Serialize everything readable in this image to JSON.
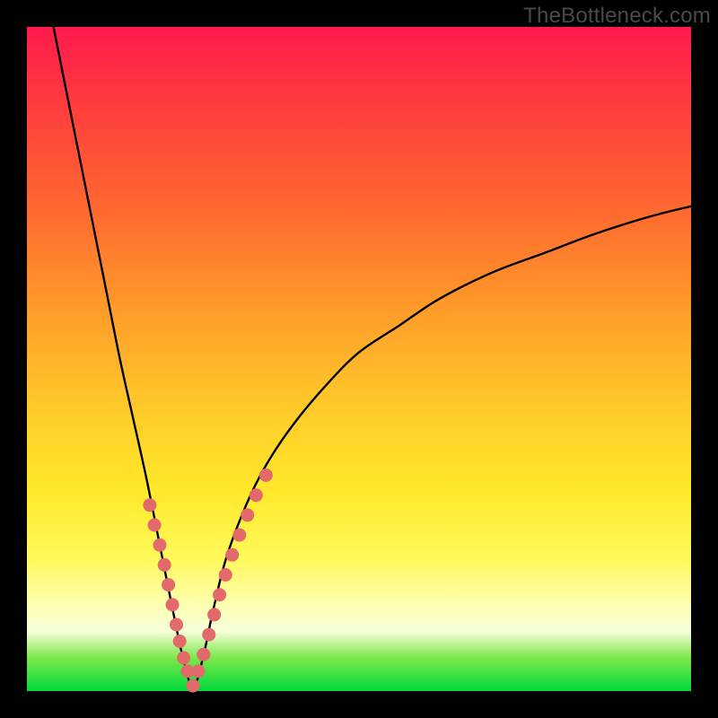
{
  "watermark": "TheBottleneck.com",
  "colors": {
    "curve_stroke": "#000000",
    "marker_fill": "#e36a6a",
    "marker_stroke": "#d85c5c",
    "frame": "#000000"
  },
  "chart_data": {
    "type": "line",
    "title": "",
    "xlabel": "",
    "ylabel": "",
    "xlim": [
      0,
      100
    ],
    "ylim": [
      0,
      100
    ],
    "notes": "V-shaped bottleneck curve. Y-axis inverted visually: 0 at bottom (green/good), 100 at top (red/bad). Minimum (optimal match) occurs near x≈25 with y≈0. Left branch rises steeply to y≈100 at x≈4; right branch rises asymptotically toward y≈73 at x=100.",
    "series": [
      {
        "name": "bottleneck-curve",
        "x": [
          4,
          6,
          8,
          10,
          12,
          14,
          16,
          18,
          20,
          22,
          23.5,
          25,
          26.5,
          28,
          30,
          33,
          36,
          40,
          45,
          50,
          56,
          62,
          70,
          78,
          86,
          94,
          100
        ],
        "y": [
          100,
          90,
          80,
          70,
          60,
          50,
          41,
          32,
          22,
          12,
          5,
          0.5,
          5,
          12,
          20,
          28,
          34,
          40,
          46,
          51,
          55,
          59,
          63,
          66,
          69,
          71.5,
          73
        ]
      }
    ],
    "markers": {
      "name": "data-points",
      "x": [
        18.5,
        19.2,
        20.0,
        20.7,
        21.3,
        21.9,
        22.5,
        23.0,
        23.6,
        24.2,
        25.0,
        25.8,
        26.6,
        27.4,
        28.2,
        29.0,
        29.9,
        30.9,
        32.0,
        33.2,
        34.5,
        36.0
      ],
      "y": [
        28,
        25,
        22,
        19,
        16,
        13,
        10,
        7.5,
        5,
        3,
        0.8,
        3,
        5.5,
        8.5,
        11.5,
        14.5,
        17.5,
        20.5,
        23.5,
        26.5,
        29.5,
        32.5
      ]
    }
  }
}
